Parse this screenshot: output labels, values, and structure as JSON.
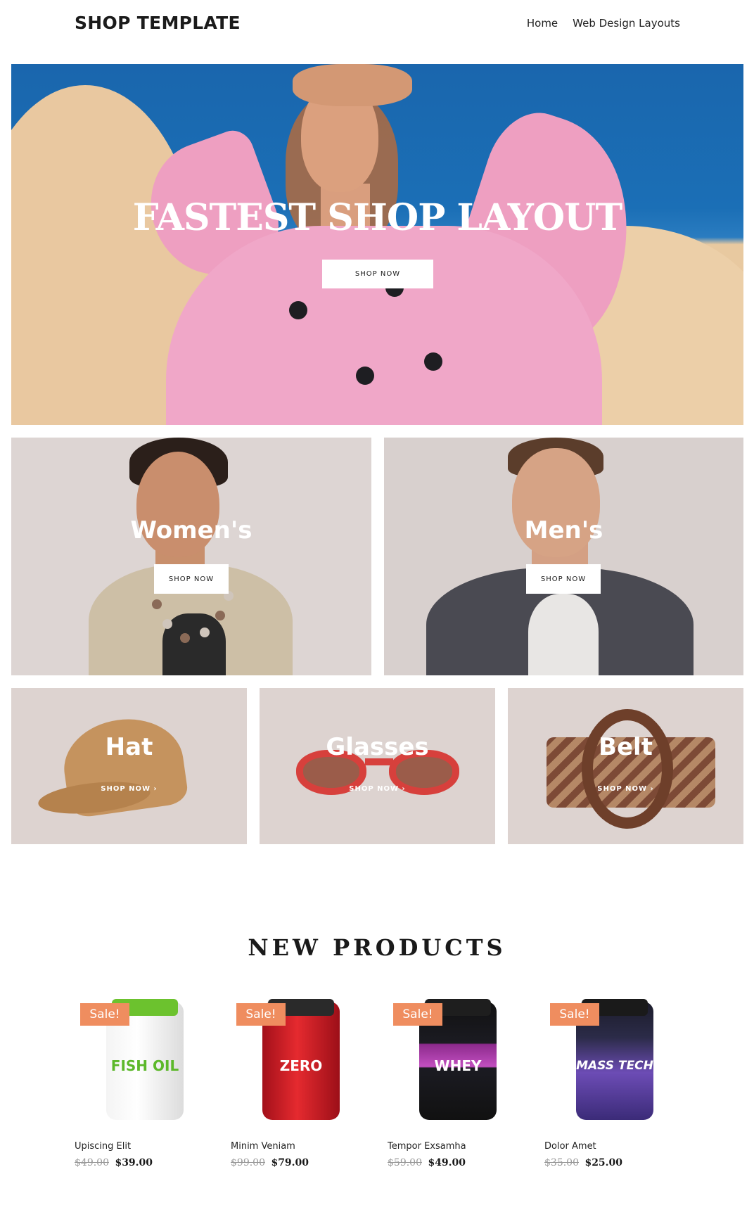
{
  "header": {
    "logo": "SHOP TEMPLATE",
    "nav": [
      {
        "label": "Home"
      },
      {
        "label": "Web Design Layouts"
      }
    ]
  },
  "hero": {
    "title": "FASTEST SHOP LAYOUT",
    "button": "SHOP NOW"
  },
  "categories_large": [
    {
      "title": "Women's",
      "button": "SHOP NOW"
    },
    {
      "title": "Men's",
      "button": "SHOP NOW"
    }
  ],
  "categories_small": [
    {
      "title": "Hat",
      "link": "SHOP NOW ›"
    },
    {
      "title": "Glasses",
      "link": "SHOP NOW ›"
    },
    {
      "title": "Belt",
      "link": "SHOP NOW ›"
    }
  ],
  "new_products": {
    "title": "NEW PRODUCTS",
    "items": [
      {
        "badge": "Sale!",
        "label_text": "FISH OIL",
        "name": "Upiscing Elit",
        "old_price": "$49.00",
        "price": "$39.00"
      },
      {
        "badge": "Sale!",
        "label_text": "ZERO",
        "name": "Minim Veniam",
        "old_price": "$99.00",
        "price": "$79.00"
      },
      {
        "badge": "Sale!",
        "label_text": "WHEY",
        "name": "Tempor Exsamha",
        "old_price": "$59.00",
        "price": "$49.00"
      },
      {
        "badge": "Sale!",
        "label_text": "MASS TECH",
        "name": "Dolor Amet",
        "old_price": "$35.00",
        "price": "$25.00"
      }
    ]
  },
  "colors": {
    "sale_badge": "#ef8d5f",
    "hero_sky": "#1b6fb6",
    "hero_blazer": "#f0a7c8",
    "panel_bg": "#ddd3d0"
  }
}
